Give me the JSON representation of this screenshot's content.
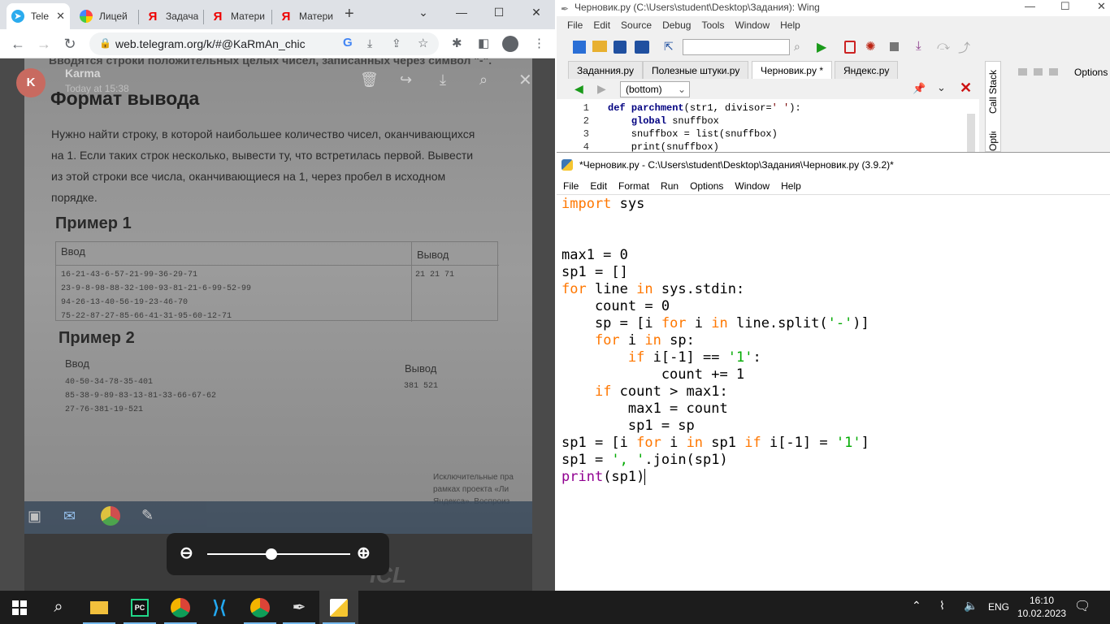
{
  "chrome": {
    "tabs": [
      {
        "label": "Tele",
        "icon": "telegram-icon"
      },
      {
        "label": "Лицей",
        "icon": "yandex-lyceum-icon"
      },
      {
        "label": "Задача",
        "icon": "yandex-icon"
      },
      {
        "label": "Матери",
        "icon": "yandex-icon"
      },
      {
        "label": "Матери",
        "icon": "yandex-icon"
      }
    ],
    "url": "web.telegram.org/k/#@KaRmAn_chic",
    "viewer": {
      "sender_initial": "K",
      "sender_name": "Karma",
      "sender_time": "Today at 15:38",
      "photo": {
        "top_text": "Вводятся строки положительных целых чисел, записанных через символ \"-\".",
        "heading": "Формат вывода",
        "paragraph_lines": [
          "Нужно найти строку, в которой наибольшее количество чисел, оканчивающихся",
          "на 1. Если таких строк несколько, вывести ту, что встретилась первой. Вывести",
          "из этой строки все числа, оканчивающиеся на 1, через пробел в исходном",
          "порядке."
        ],
        "example1_title": "Пример 1",
        "example1_input_header": "Ввод",
        "example1_output_header": "Вывод",
        "example1_input": [
          "16-21-43-6-57-21-99-36-29-71",
          "23-9-8-98-88-32-100-93-81-21-6-99-52-99",
          "94-26-13-40-56-19-23-46-70",
          "75-22-87-27-85-66-41-31-95-60-12-71"
        ],
        "example1_output": "21 21 71",
        "example2_title": "Пример 2",
        "example2_input_header": "Ввод",
        "example2_output_header": "Вывод",
        "example2_input": [
          "40-50-34-78-35-401",
          "85-38-9-89-83-13-81-33-66-67-62",
          "27-76-381-19-521"
        ],
        "example2_output": "381 521",
        "footnote_lines": [
          "Исключительные пра",
          "рамках проекта «Ли",
          "Яндекса». Воспроиз"
        ],
        "brand": "ICL"
      },
      "zoom_level": 0.45
    }
  },
  "wing": {
    "title": "Черновик.py (C:\\Users\\student\\Desktop\\Задания): Wing",
    "menu": [
      "File",
      "Edit",
      "Source",
      "Debug",
      "Tools",
      "Window",
      "Help"
    ],
    "tabs": [
      "Заданния.py",
      "Полезные штуки.py",
      "Черновик.py *",
      "Яндекс.py"
    ],
    "scope": "(bottom)",
    "side_tabs": [
      "Call Stack",
      "Options"
    ],
    "options_label": "Options",
    "lines": [
      {
        "n": "1",
        "text": "def parchment(str1, divisor=' '):"
      },
      {
        "n": "2",
        "text": "    global snuffbox"
      },
      {
        "n": "3",
        "text": "    snuffbox = list(snuffbox)"
      },
      {
        "n": "4",
        "text": "    print(snuffbox)"
      }
    ]
  },
  "idle": {
    "title": "*Черновик.py - C:\\Users\\student\\Desktop\\Задания\\Черновик.py (3.9.2)*",
    "menu": [
      "File",
      "Edit",
      "Format",
      "Run",
      "Options",
      "Window",
      "Help"
    ]
  },
  "taskbar": {
    "language": "ENG",
    "time": "16:10",
    "date": "10.02.2023"
  }
}
